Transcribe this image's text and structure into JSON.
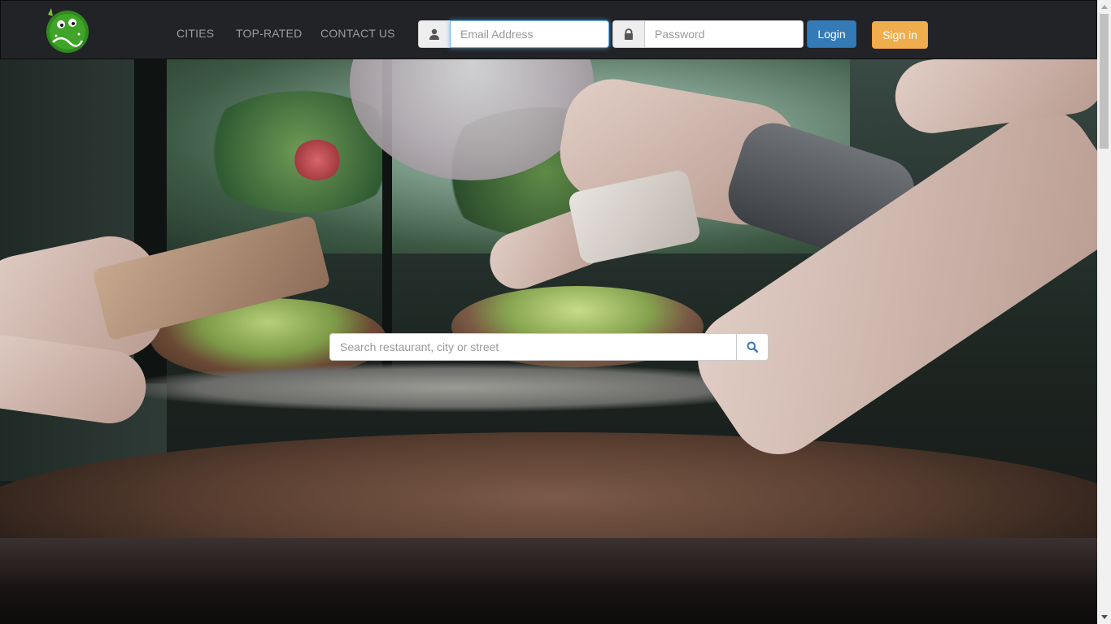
{
  "brand": {
    "logo": "green-monster-logo"
  },
  "nav": {
    "links": [
      "CITIES",
      "TOP-RATED",
      "CONTACT US"
    ]
  },
  "login": {
    "email_placeholder": "Email Address",
    "password_placeholder": "Password",
    "login_label": "Login",
    "signin_label": "Sign in"
  },
  "search": {
    "placeholder": "Search restaurant, city or street"
  },
  "icons": {
    "user": "user-icon",
    "lock": "lock-icon",
    "search": "search-icon"
  },
  "colors": {
    "navbar": "#222326",
    "login_button": "#337ab7",
    "signin_button": "#f0ad4e",
    "nav_link": "#9d9d9d"
  }
}
